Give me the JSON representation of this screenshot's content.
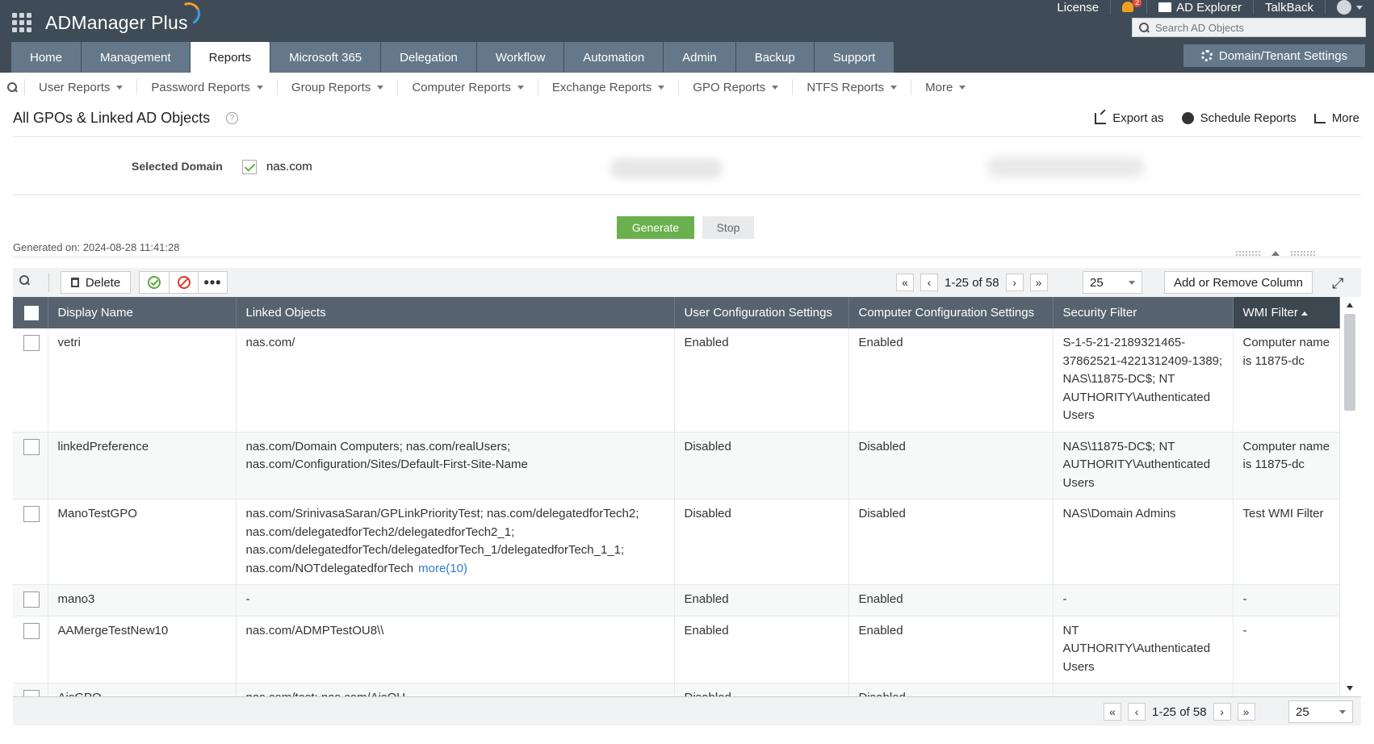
{
  "app": {
    "name": "ADManager Plus"
  },
  "top_links": {
    "license": "License",
    "notifications_count": "2",
    "ad_explorer": "AD Explorer",
    "talkback": "TalkBack"
  },
  "search": {
    "placeholder": "Search AD Objects"
  },
  "nav_tabs": [
    {
      "label": "Home"
    },
    {
      "label": "Management"
    },
    {
      "label": "Reports"
    },
    {
      "label": "Microsoft 365"
    },
    {
      "label": "Delegation"
    },
    {
      "label": "Workflow"
    },
    {
      "label": "Automation"
    },
    {
      "label": "Admin"
    },
    {
      "label": "Backup"
    },
    {
      "label": "Support"
    }
  ],
  "active_tab": "Reports",
  "domain_settings_label": "Domain/Tenant Settings",
  "sub_nav": [
    {
      "label": "User Reports"
    },
    {
      "label": "Password Reports"
    },
    {
      "label": "Group Reports"
    },
    {
      "label": "Computer Reports"
    },
    {
      "label": "Exchange Reports"
    },
    {
      "label": "GPO Reports"
    },
    {
      "label": "NTFS Reports"
    },
    {
      "label": "More"
    }
  ],
  "page": {
    "title": "All GPOs & Linked AD Objects",
    "help": "?",
    "actions": {
      "export": "Export as",
      "schedule": "Schedule Reports",
      "more": "More"
    }
  },
  "domain": {
    "label": "Selected Domain",
    "value": "nas.com"
  },
  "buttons": {
    "generate": "Generate",
    "stop": "Stop"
  },
  "generated_on": "Generated on: 2024-08-28 11:41:28",
  "toolbar": {
    "delete": "Delete",
    "more": "•••",
    "add_remove_columns": "Add or Remove Column"
  },
  "pagination": {
    "range": "1-25 of 58",
    "page_size": "25",
    "first": "«",
    "prev": "‹",
    "next": "›",
    "last": "»"
  },
  "table": {
    "headers": [
      "Display Name",
      "Linked Objects",
      "User Configuration Settings",
      "Computer Configuration Settings",
      "Security Filter",
      "WMI Filter"
    ],
    "rows": [
      {
        "name": "vetri",
        "linked": "nas.com/",
        "user_cfg": "Enabled",
        "comp_cfg": "Enabled",
        "security": "S-1-5-21-2189321465-37862521-4221312409-1389; NAS\\11875-DC$; NT AUTHORITY\\Authenticated Users",
        "wmi": "Computer name is 11875-dc",
        "more": ""
      },
      {
        "name": "linkedPreference",
        "linked": "nas.com/Domain Computers; nas.com/realUsers; nas.com/Configuration/Sites/Default-First-Site-Name",
        "user_cfg": "Disabled",
        "comp_cfg": "Disabled",
        "security": "NAS\\11875-DC$; NT AUTHORITY\\Authenticated Users",
        "wmi": "Computer name is 11875-dc",
        "more": ""
      },
      {
        "name": "ManoTestGPO",
        "linked": "nas.com/SrinivasaSaran/GPLinkPriorityTest; nas.com/delegatedforTech2; nas.com/delegatedforTech2/delegatedforTech2_1; nas.com/delegatedforTech/delegatedforTech_1/delegatedforTech_1_1; nas.com/NOTdelegatedforTech",
        "user_cfg": "Disabled",
        "comp_cfg": "Disabled",
        "security": "NAS\\Domain Admins",
        "wmi": "Test WMI Filter",
        "more": "more(10)"
      },
      {
        "name": "mano3",
        "linked": "-",
        "user_cfg": "Enabled",
        "comp_cfg": "Enabled",
        "security": "-",
        "wmi": "-",
        "more": ""
      },
      {
        "name": "AAMergeTestNew10",
        "linked": "nas.com/ADMPTestOU8\\\\",
        "user_cfg": "Enabled",
        "comp_cfg": "Enabled",
        "security": "NT AUTHORITY\\Authenticated Users",
        "wmi": "-",
        "more": ""
      },
      {
        "name": "AisGPO",
        "linked": "nas.com/test; nas.com/AisOU",
        "user_cfg": "Disabled",
        "comp_cfg": "Disabled",
        "security": "-",
        "wmi": "-",
        "more": ""
      }
    ]
  },
  "colors": {
    "header_bg": "#3f4c57",
    "tab_bg": "#64788a",
    "generate_green": "#6ab04c",
    "link_blue": "#2b7bd0",
    "table_header": "#56636e"
  }
}
